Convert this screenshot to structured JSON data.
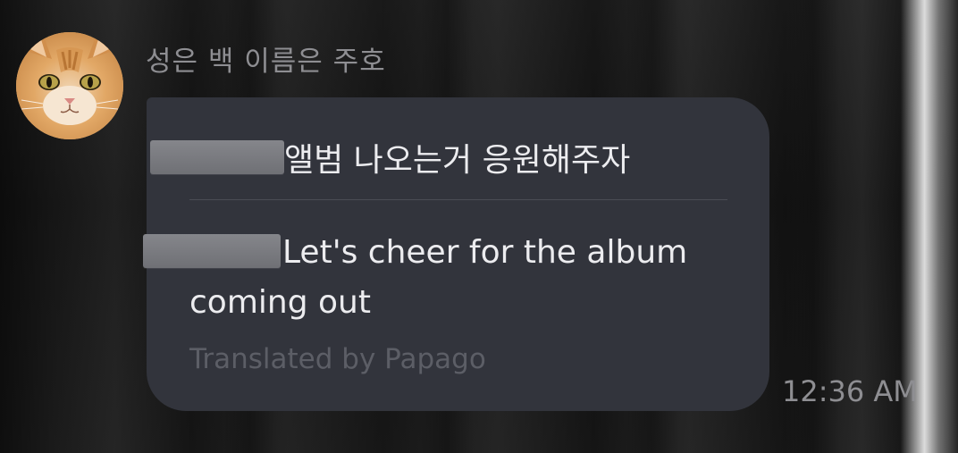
{
  "sender": {
    "name": "성은 백 이름은 주호",
    "avatar_icon": "cat-avatar-icon"
  },
  "message": {
    "original_text": "앨범 나오는거 응원해주자",
    "translated_text": "Let's cheer for the album coming out",
    "translation_credit": "Translated by Papago",
    "timestamp": "12:36 AM"
  },
  "colors": {
    "bubble": "#32343c",
    "text": "#ececef",
    "muted": "#8e8e92",
    "credit": "#5c5e66"
  }
}
